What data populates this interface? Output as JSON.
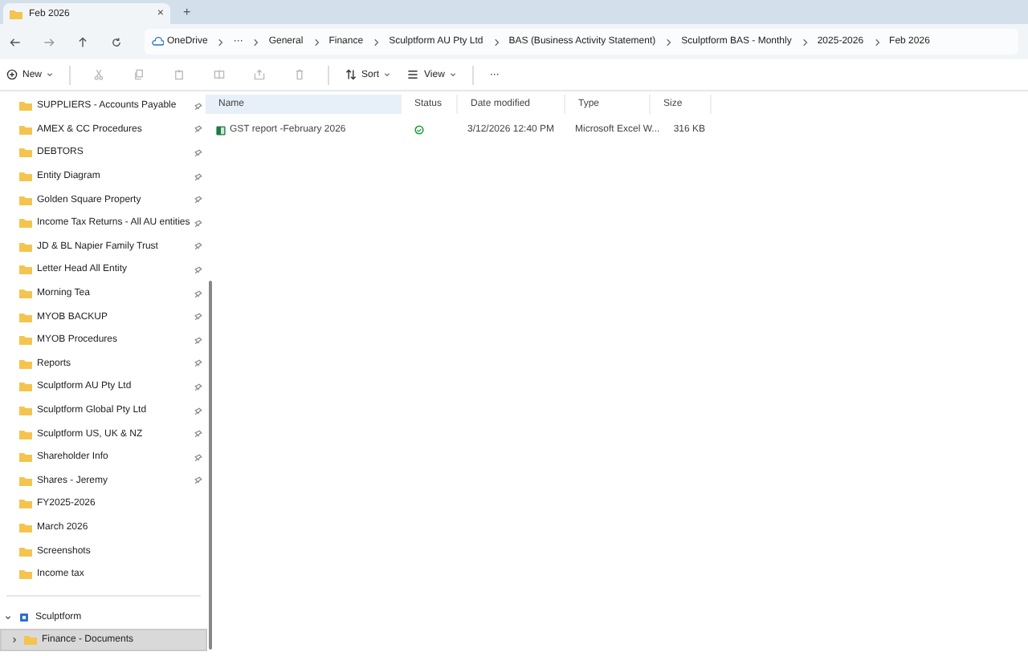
{
  "tab": {
    "title": "Feb 2026",
    "close": "×",
    "new": "+"
  },
  "breadcrumbs": [
    {
      "label": "OneDrive",
      "kind": "cloud"
    },
    {
      "label": "···",
      "kind": "more"
    },
    {
      "label": "General",
      "kind": "folder"
    },
    {
      "label": "Finance",
      "kind": "folder"
    },
    {
      "label": "Sculptform AU Pty Ltd",
      "kind": "folder"
    },
    {
      "label": "BAS (Business Activity Statement)",
      "kind": "folder"
    },
    {
      "label": "Sculptform BAS - Monthly",
      "kind": "folder"
    },
    {
      "label": "2025-2026",
      "kind": "folder"
    },
    {
      "label": "Feb 2026",
      "kind": "folder"
    }
  ],
  "toolbar": {
    "new": "New",
    "sort": "Sort",
    "view": "View",
    "more": "···"
  },
  "sidebar": {
    "items": [
      {
        "label": "SUPPLIERS - Accounts Payable",
        "pinned": true
      },
      {
        "label": "AMEX & CC Procedures",
        "pinned": true
      },
      {
        "label": "DEBTORS",
        "pinned": true
      },
      {
        "label": "Entity Diagram",
        "pinned": true
      },
      {
        "label": "Golden Square Property",
        "pinned": true
      },
      {
        "label": "Income Tax Returns - All AU entities",
        "pinned": true
      },
      {
        "label": "JD & BL Napier Family Trust",
        "pinned": true
      },
      {
        "label": "Letter Head All Entity",
        "pinned": true
      },
      {
        "label": "Morning Tea",
        "pinned": true
      },
      {
        "label": "MYOB BACKUP",
        "pinned": true
      },
      {
        "label": "MYOB Procedures",
        "pinned": true
      },
      {
        "label": "Reports",
        "pinned": true
      },
      {
        "label": "Sculptform AU Pty Ltd",
        "pinned": true
      },
      {
        "label": "Sculptform Global Pty Ltd",
        "pinned": true
      },
      {
        "label": "Sculptform US, UK & NZ",
        "pinned": true
      },
      {
        "label": "Shareholder Info",
        "pinned": true
      },
      {
        "label": "Shares - Jeremy",
        "pinned": true
      },
      {
        "label": "FY2025-2026",
        "pinned": false
      },
      {
        "label": "March 2026",
        "pinned": false
      },
      {
        "label": "Screenshots",
        "pinned": false
      },
      {
        "label": "Income tax",
        "pinned": false
      }
    ],
    "tree": [
      {
        "label": "Sculptform",
        "expanded": true,
        "selected": false,
        "children": [
          {
            "label": "Finance - Documents",
            "expanded": false,
            "selected": true
          }
        ]
      }
    ]
  },
  "table": {
    "columns": [
      {
        "label": "Name",
        "sorted": true
      },
      {
        "label": "Status",
        "sorted": false
      },
      {
        "label": "Date modified",
        "sorted": false
      },
      {
        "label": "Type",
        "sorted": false
      },
      {
        "label": "Size",
        "sorted": false
      }
    ],
    "rows": [
      {
        "name": "GST report -February 2026",
        "synced": true,
        "date": "3/12/2026 12:40 PM",
        "type": "Microsoft Excel W...",
        "size": "316 KB"
      }
    ]
  }
}
